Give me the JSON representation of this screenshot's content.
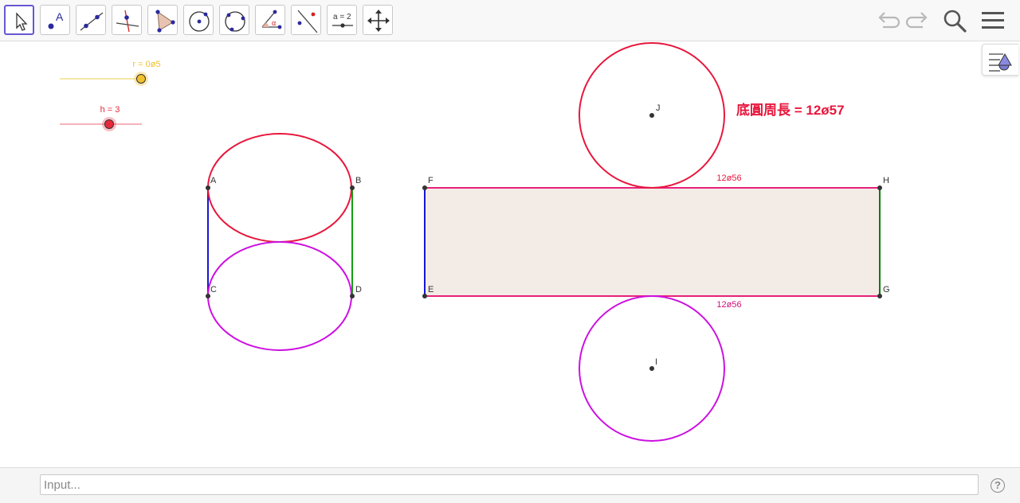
{
  "toolbar": {
    "tools": [
      {
        "name": "move-tool-icon"
      },
      {
        "name": "point-tool-icon",
        "glyph": "A"
      },
      {
        "name": "line-tool-icon"
      },
      {
        "name": "perpendicular-line-tool-icon"
      },
      {
        "name": "polygon-tool-icon"
      },
      {
        "name": "circle-center-point-tool-icon"
      },
      {
        "name": "circle-three-points-tool-icon"
      },
      {
        "name": "angle-tool-icon",
        "glyph": "α"
      },
      {
        "name": "reflect-about-line-tool-icon"
      },
      {
        "name": "slider-tool-icon",
        "glyph": "a = 2"
      },
      {
        "name": "move-graphics-view-tool-icon"
      }
    ],
    "right": [
      "undo-icon",
      "redo-icon",
      "search-icon",
      "menu-icon"
    ]
  },
  "sliders": {
    "r": {
      "label": "r = 0ø5",
      "color": "#f2c12e",
      "value_fraction": 1.0
    },
    "h": {
      "label": "h = 3",
      "color": "#e8293c",
      "value_fraction": 0.6
    }
  },
  "points": {
    "A": "A",
    "B": "B",
    "C": "C",
    "D": "D",
    "E": "E",
    "F": "F",
    "G": "G",
    "H": "H",
    "I": "I",
    "J": "J"
  },
  "labels": {
    "top_edge_length": "12ø56",
    "bottom_edge_length": "12ø56",
    "base_circumference": "底圓周長 = 12ø57"
  },
  "colors": {
    "red": "#e8173d",
    "magenta": "#cc11e0",
    "blue": "#1a16d4",
    "green": "#12a012",
    "dark_green": "#0f7a0f",
    "pink_edge": "#e8217a",
    "rect_fill": "#f2ebe6",
    "accent": "#6557d2"
  },
  "input": {
    "placeholder": "Input..."
  },
  "help": {
    "glyph": "?"
  }
}
